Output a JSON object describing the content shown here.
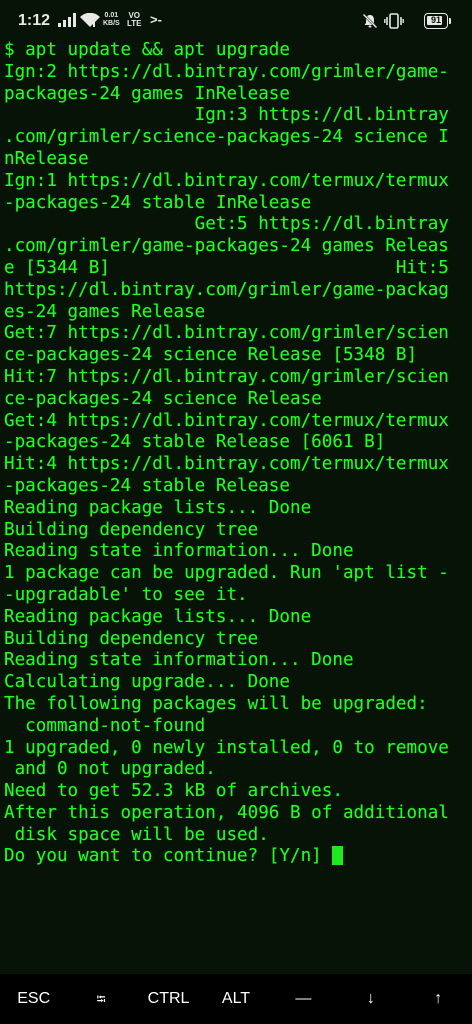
{
  "status_bar": {
    "time": "1:12",
    "speed_value": "0.01",
    "speed_unit": "KB/S",
    "network_top": "VO",
    "network_bottom": "LTE",
    "notification": ">-",
    "battery": "91",
    "battery_fraction": 0.91,
    "icons": [
      "signal-icon",
      "wifi-icon",
      "mute-icon",
      "vibrate-icon",
      "battery-icon"
    ]
  },
  "terminal": {
    "colors": {
      "background": "#061306",
      "text": "#21ff21"
    },
    "lines": [
      "$ apt update && apt upgrade",
      "Ign:2 https://dl.bintray.com/grimler/game-",
      "packages-24 games InRelease",
      "                  Ign:3 https://dl.bintray",
      ".com/grimler/science-packages-24 science I",
      "nRelease",
      "Ign:1 https://dl.bintray.com/termux/termux",
      "-packages-24 stable InRelease",
      "                  Get:5 https://dl.bintray",
      ".com/grimler/game-packages-24 games Releas",
      "e [5344 B]                           Hit:5",
      "https://dl.bintray.com/grimler/game-packag",
      "es-24 games Release",
      "Get:7 https://dl.bintray.com/grimler/scien",
      "ce-packages-24 science Release [5348 B]",
      "Hit:7 https://dl.bintray.com/grimler/scien",
      "ce-packages-24 science Release",
      "Get:4 https://dl.bintray.com/termux/termux",
      "-packages-24 stable Release [6061 B]",
      "Hit:4 https://dl.bintray.com/termux/termux",
      "-packages-24 stable Release",
      "Reading package lists... Done",
      "Building dependency tree",
      "Reading state information... Done",
      "1 package can be upgraded. Run 'apt list -",
      "-upgradable' to see it.",
      "Reading package lists... Done",
      "Building dependency tree",
      "Reading state information... Done",
      "Calculating upgrade... Done",
      "The following packages will be upgraded:",
      "  command-not-found",
      "1 upgraded, 0 newly installed, 0 to remove",
      " and 0 not upgraded.",
      "Need to get 52.3 kB of archives.",
      "After this operation, 4096 B of additional",
      " disk space will be used.",
      "Do you want to continue? [Y/n] "
    ]
  },
  "extra_keys": [
    {
      "name": "esc-key",
      "label": "ESC"
    },
    {
      "name": "tab-key",
      "label": "⭾"
    },
    {
      "name": "ctrl-key",
      "label": "CTRL"
    },
    {
      "name": "alt-key",
      "label": "ALT"
    },
    {
      "name": "dash-key",
      "label": "—"
    },
    {
      "name": "arrow-down-key",
      "label": "↓"
    },
    {
      "name": "arrow-up-key",
      "label": "↑"
    }
  ]
}
